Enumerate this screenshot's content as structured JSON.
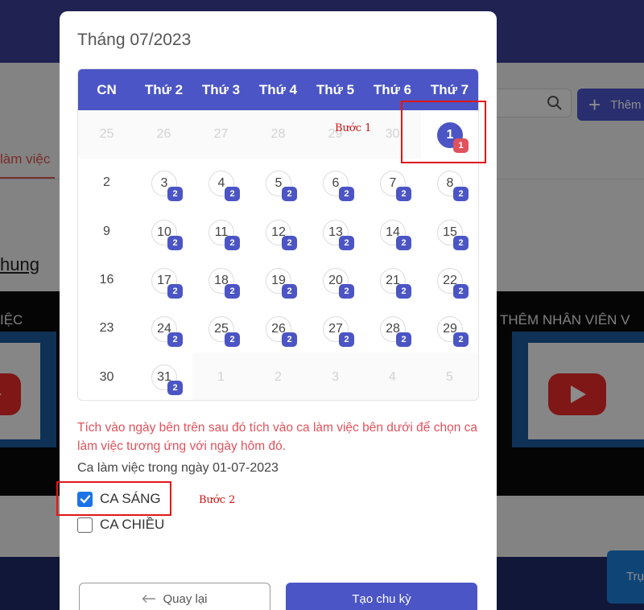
{
  "background": {
    "add_button_label": "Thêm",
    "tab_label": "làm việc",
    "section_heading": "hung",
    "video_left_caption": "IỆC",
    "video_right_caption": "THÊM NHÂN VIÊN V",
    "chat_button_label": "Trự"
  },
  "modal": {
    "title": "Tháng 07/2023",
    "weekdays": [
      "CN",
      "Thứ 2",
      "Thứ 3",
      "Thứ 4",
      "Thứ 5",
      "Thứ 6",
      "Thứ 7"
    ],
    "days": [
      {
        "day": "25",
        "muted": true
      },
      {
        "day": "26",
        "muted": true
      },
      {
        "day": "27",
        "muted": true
      },
      {
        "day": "28",
        "muted": true
      },
      {
        "day": "29",
        "muted": true
      },
      {
        "day": "30",
        "muted": true
      },
      {
        "day": "1",
        "selected": true,
        "badge": "1"
      },
      {
        "day": "2"
      },
      {
        "day": "3",
        "badge": "2"
      },
      {
        "day": "4",
        "badge": "2"
      },
      {
        "day": "5",
        "badge": "2"
      },
      {
        "day": "6",
        "badge": "2"
      },
      {
        "day": "7",
        "badge": "2"
      },
      {
        "day": "8",
        "badge": "2"
      },
      {
        "day": "9"
      },
      {
        "day": "10",
        "badge": "2"
      },
      {
        "day": "11",
        "badge": "2"
      },
      {
        "day": "12",
        "badge": "2"
      },
      {
        "day": "13",
        "badge": "2"
      },
      {
        "day": "14",
        "badge": "2"
      },
      {
        "day": "15",
        "badge": "2"
      },
      {
        "day": "16"
      },
      {
        "day": "17",
        "badge": "2"
      },
      {
        "day": "18",
        "badge": "2"
      },
      {
        "day": "19",
        "badge": "2"
      },
      {
        "day": "20",
        "badge": "2"
      },
      {
        "day": "21",
        "badge": "2"
      },
      {
        "day": "22",
        "badge": "2"
      },
      {
        "day": "23"
      },
      {
        "day": "24",
        "badge": "2"
      },
      {
        "day": "25",
        "badge": "2"
      },
      {
        "day": "26",
        "badge": "2"
      },
      {
        "day": "27",
        "badge": "2"
      },
      {
        "day": "28",
        "badge": "2"
      },
      {
        "day": "29",
        "badge": "2"
      },
      {
        "day": "30"
      },
      {
        "day": "31",
        "badge": "2"
      },
      {
        "day": "1",
        "muted": true
      },
      {
        "day": "2",
        "muted": true
      },
      {
        "day": "3",
        "muted": true
      },
      {
        "day": "4",
        "muted": true
      },
      {
        "day": "5",
        "muted": true
      }
    ],
    "hint": "Tích vào ngày bên trên sau đó tích vào ca làm việc bên dưới để chọn ca làm việc tương ứng với ngày hôm đó.",
    "shift_section_title": "Ca làm việc trong ngày 01-07-2023",
    "shifts": [
      {
        "label": "CA SÁNG",
        "checked": true
      },
      {
        "label": "CA CHIỀU",
        "checked": false
      }
    ],
    "back_label": "Quay lại",
    "create_label": "Tạo chu kỳ"
  },
  "annotations": {
    "step1": "Bước 1",
    "step2": "Bước 2"
  },
  "colors": {
    "primary": "#4b55c5",
    "hint_red": "#e0525c",
    "annotation_red": "#e01717",
    "checkbox_blue": "#1a73e8"
  }
}
